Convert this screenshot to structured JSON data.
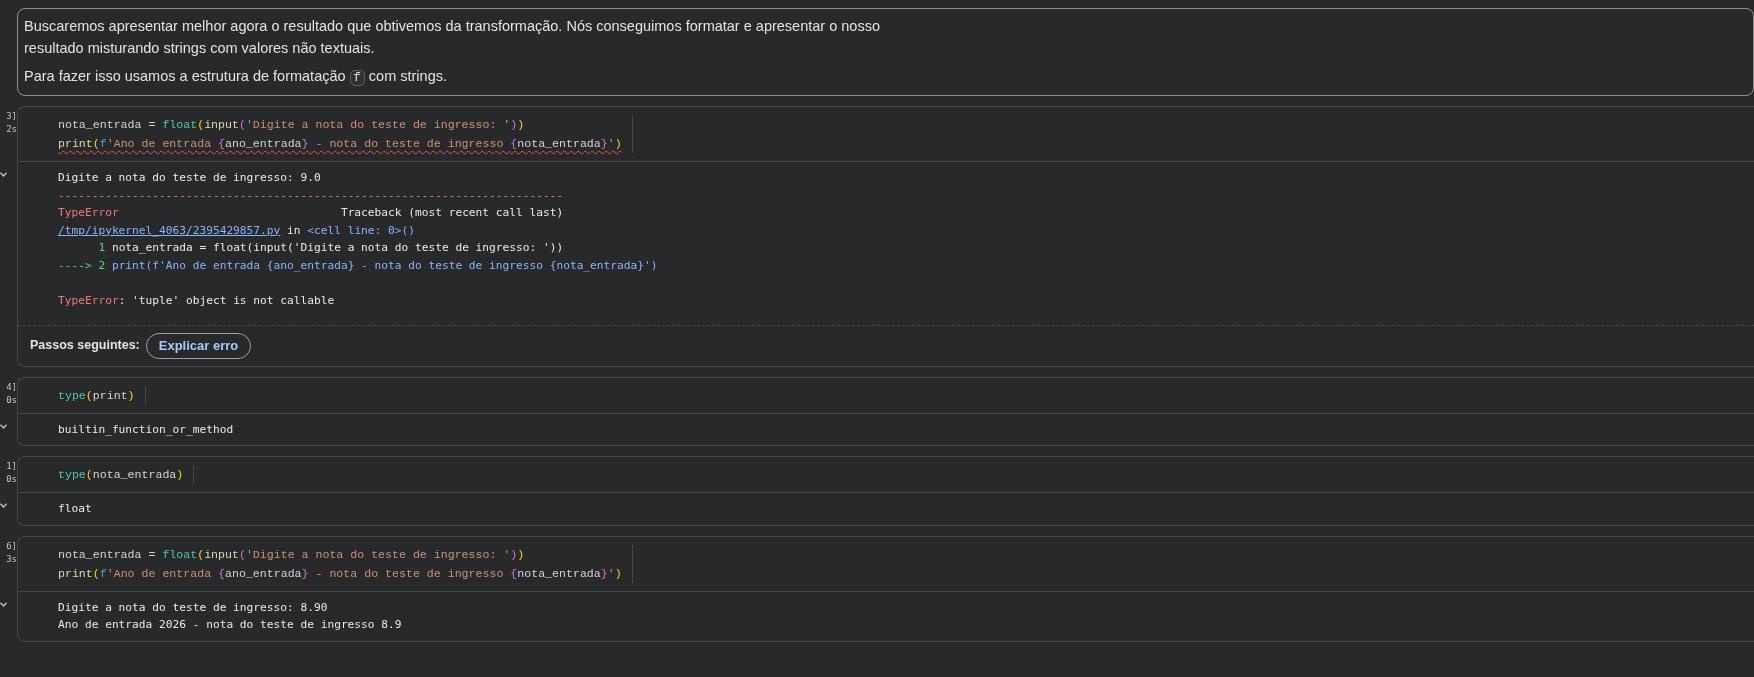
{
  "markdown": {
    "paragraphs": [
      [
        {
          "kind": "text",
          "text": "Buscaremos apresentar melhor agora o resultado que obtivemos da transformação. Nós conseguimos formatar e apresentar o nosso resultado misturando strings com valores não textuais."
        }
      ],
      [
        {
          "kind": "text",
          "text": "Para fazer isso usamos a estrutura de formatação "
        },
        {
          "kind": "code",
          "text": "f"
        },
        {
          "kind": "text",
          "text": " com strings."
        }
      ]
    ]
  },
  "cells": [
    {
      "execution_count": "3]",
      "duration": "2s",
      "code": [
        {
          "squiggle": false,
          "segments": [
            {
              "kind": "plain",
              "text": "nota_entrada = "
            },
            {
              "kind": "builtin",
              "text": "float"
            },
            {
              "kind": "paren",
              "text": "("
            },
            {
              "kind": "func",
              "text": "input"
            },
            {
              "kind": "paren2",
              "text": "("
            },
            {
              "kind": "string",
              "text": "'Digite a nota do teste de ingresso: '"
            },
            {
              "kind": "paren2",
              "text": ")"
            },
            {
              "kind": "paren",
              "text": ")"
            }
          ]
        },
        {
          "squiggle": true,
          "segments": [
            {
              "kind": "func",
              "text": "print"
            },
            {
              "kind": "paren",
              "text": "("
            },
            {
              "kind": "keyword",
              "text": "f"
            },
            {
              "kind": "string",
              "text": "'Ano de entrada "
            },
            {
              "kind": "brace",
              "text": "{"
            },
            {
              "kind": "plain",
              "text": "ano_entrada"
            },
            {
              "kind": "brace",
              "text": "}"
            },
            {
              "kind": "string",
              "text": " - nota do teste de ingresso "
            },
            {
              "kind": "brace",
              "text": "{"
            },
            {
              "kind": "plain",
              "text": "nota_entrada"
            },
            {
              "kind": "brace",
              "text": "}"
            },
            {
              "kind": "string",
              "text": "'"
            },
            {
              "kind": "paren",
              "text": ")"
            }
          ]
        }
      ],
      "output": [
        [
          {
            "kind": "plain",
            "text": "Digite a nota do teste de ingresso: 9.0"
          }
        ],
        [
          {
            "kind": "error",
            "text": "---------------------------------------------------------------------------"
          }
        ],
        [
          {
            "kind": "error",
            "text": "TypeError                                 "
          },
          {
            "kind": "plain",
            "text": "Traceback (most recent call last)"
          }
        ],
        [
          {
            "kind": "link",
            "text": "/tmp/ipykernel_4063/2395429857.py"
          },
          {
            "kind": "plain",
            "text": " in "
          },
          {
            "kind": "blue",
            "text": "<cell line: 0>()"
          }
        ],
        [
          {
            "kind": "green",
            "text": "      1 "
          },
          {
            "kind": "plain",
            "text": "nota_entrada = float(input('Digite a nota do teste de ingresso: '))"
          }
        ],
        [
          {
            "kind": "green",
            "text": "----> 2 "
          },
          {
            "kind": "blue",
            "text": "print(f'Ano de entrada {ano_entrada} - nota do teste de ingresso {nota_entrada}')"
          }
        ],
        [
          {
            "kind": "gap"
          },
          {
            "kind": "error",
            "text": "TypeError"
          },
          {
            "kind": "plain",
            "text": ": 'tuple' object is not callable"
          }
        ]
      ],
      "next_steps": {
        "label": "Passos seguintes:",
        "button": "Explicar erro"
      }
    },
    {
      "execution_count": "4]",
      "duration": "0s",
      "code": [
        {
          "squiggle": false,
          "segments": [
            {
              "kind": "builtin",
              "text": "type"
            },
            {
              "kind": "paren",
              "text": "("
            },
            {
              "kind": "plain",
              "text": "print"
            },
            {
              "kind": "paren",
              "text": ")"
            }
          ]
        }
      ],
      "output": [
        [
          {
            "kind": "plain",
            "text": "builtin_function_or_method"
          }
        ]
      ]
    },
    {
      "execution_count": "1]",
      "duration": "0s",
      "code": [
        {
          "squiggle": false,
          "segments": [
            {
              "kind": "builtin",
              "text": "type"
            },
            {
              "kind": "paren",
              "text": "("
            },
            {
              "kind": "plain",
              "text": "nota_entrada"
            },
            {
              "kind": "paren",
              "text": ")"
            }
          ]
        }
      ],
      "output": [
        [
          {
            "kind": "plain",
            "text": "float"
          }
        ]
      ]
    },
    {
      "execution_count": "6]",
      "duration": "3s",
      "code": [
        {
          "squiggle": false,
          "segments": [
            {
              "kind": "plain",
              "text": "nota_entrada = "
            },
            {
              "kind": "builtin",
              "text": "float"
            },
            {
              "kind": "paren",
              "text": "("
            },
            {
              "kind": "func",
              "text": "input"
            },
            {
              "kind": "paren2",
              "text": "("
            },
            {
              "kind": "string",
              "text": "'Digite a nota do teste de ingresso: '"
            },
            {
              "kind": "paren2",
              "text": ")"
            },
            {
              "kind": "paren",
              "text": ")"
            }
          ]
        },
        {
          "squiggle": false,
          "segments": [
            {
              "kind": "func",
              "text": "print"
            },
            {
              "kind": "paren",
              "text": "("
            },
            {
              "kind": "keyword",
              "text": "f"
            },
            {
              "kind": "string",
              "text": "'Ano de entrada "
            },
            {
              "kind": "brace",
              "text": "{"
            },
            {
              "kind": "plain",
              "text": "ano_entrada"
            },
            {
              "kind": "brace",
              "text": "}"
            },
            {
              "kind": "string",
              "text": " - nota do teste de ingresso "
            },
            {
              "kind": "brace",
              "text": "{"
            },
            {
              "kind": "plain",
              "text": "nota_entrada"
            },
            {
              "kind": "brace",
              "text": "}"
            },
            {
              "kind": "string",
              "text": "'"
            },
            {
              "kind": "paren",
              "text": ")"
            }
          ]
        }
      ],
      "output": [
        [
          {
            "kind": "plain",
            "text": "Digite a nota do teste de ingresso: 8.90"
          }
        ],
        [
          {
            "kind": "plain",
            "text": "Ano de entrada 2026 - nota do teste de ingresso 8.9"
          }
        ]
      ]
    }
  ]
}
